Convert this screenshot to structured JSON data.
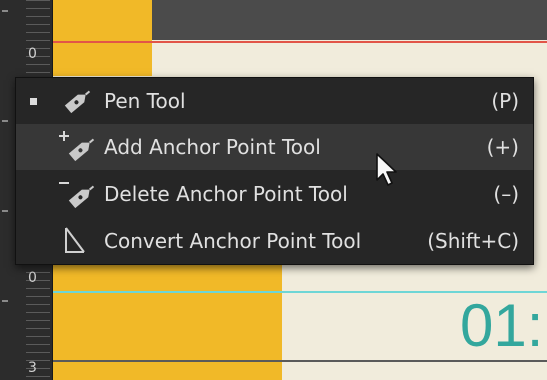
{
  "ruler": {
    "labels": [
      "0",
      "0",
      "3"
    ]
  },
  "canvas": {
    "number_text": "01:"
  },
  "menu": {
    "items": [
      {
        "label": "Pen Tool",
        "shortcut": "(P)",
        "icon": "pen-icon",
        "selected": true
      },
      {
        "label": "Add Anchor Point Tool",
        "shortcut": "(+)",
        "icon": "add-anchor-point-icon",
        "highlighted": true
      },
      {
        "label": "Delete Anchor Point Tool",
        "shortcut": "(–)",
        "icon": "delete-anchor-point-icon"
      },
      {
        "label": "Convert Anchor Point Tool",
        "shortcut": "(Shift+C)",
        "icon": "convert-anchor-point-icon"
      }
    ]
  },
  "colors": {
    "accent_orange": "#f1b928",
    "guide_red": "#e25548",
    "guide_cyan": "#6ed6d6",
    "number_teal": "#33a79d",
    "menu_bg": "#262626",
    "menu_highlight": "#373737"
  }
}
